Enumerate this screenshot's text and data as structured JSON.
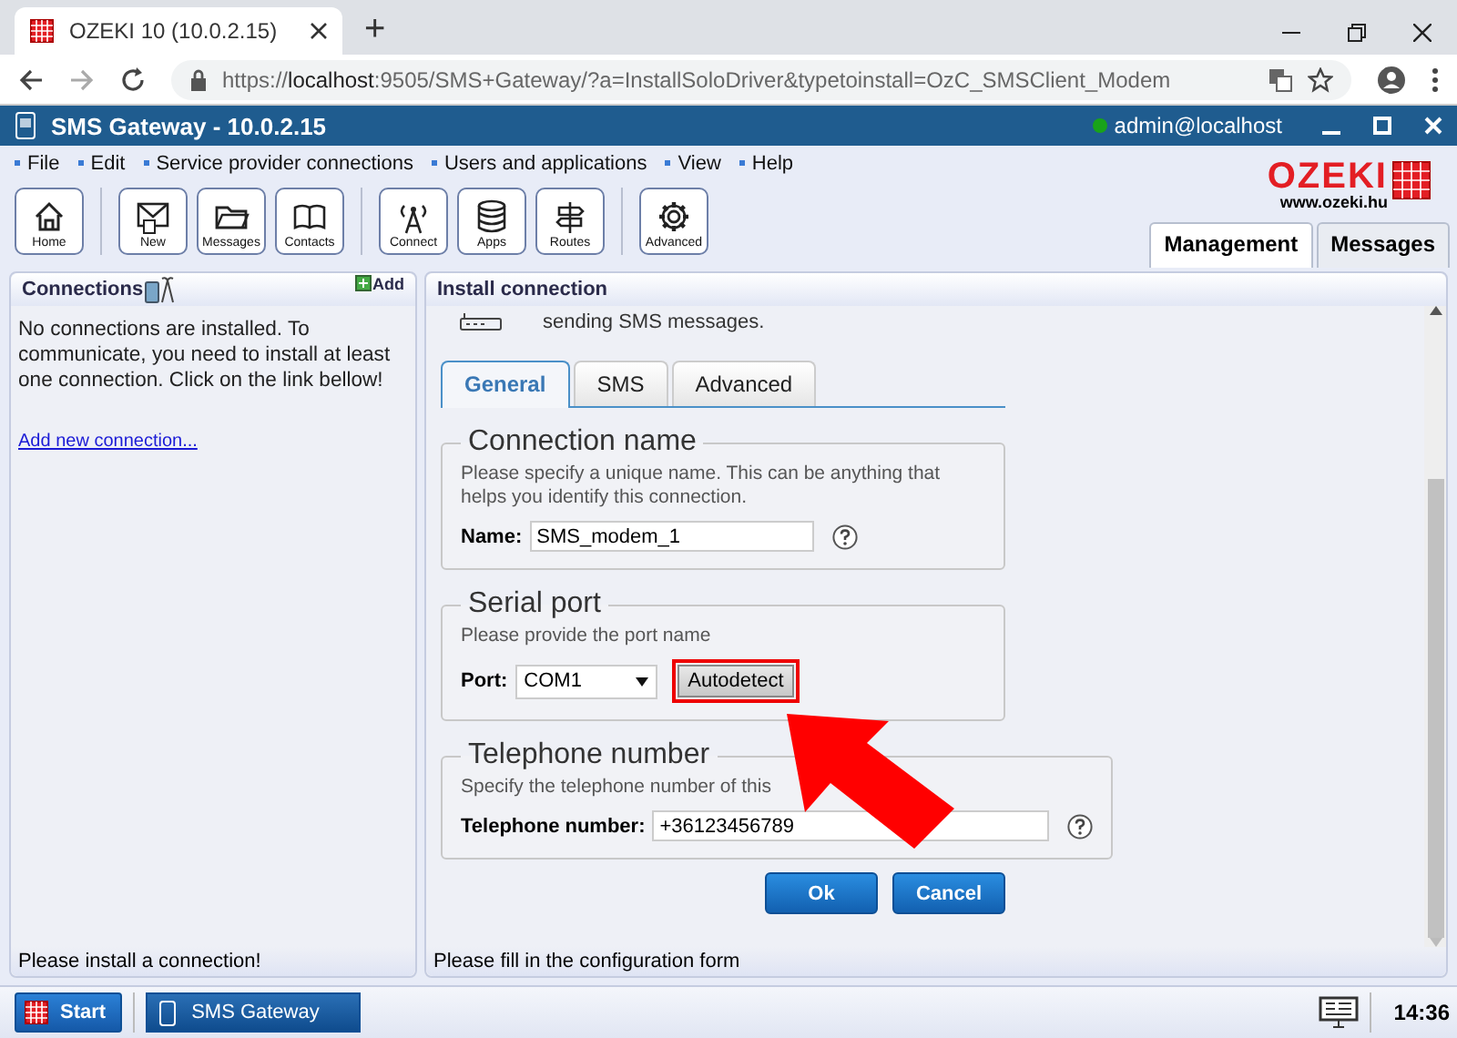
{
  "browser": {
    "tab_title": "OZEKI 10 (10.0.2.15)",
    "new_tab": "+",
    "url_scheme": "https://",
    "url_host": "localhost",
    "url_path": ":9505/SMS+Gateway/?a=InstallSoloDriver&typetoinstall=OzC_SMSClient_Modem"
  },
  "app": {
    "title": "SMS Gateway - 10.0.2.15",
    "user": "admin@localhost",
    "online": true
  },
  "menu": [
    "File",
    "Edit",
    "Service provider connections",
    "Users and applications",
    "View",
    "Help"
  ],
  "toolbar_groups": [
    [
      "Home"
    ],
    [
      "New",
      "Messages",
      "Contacts"
    ],
    [
      "Connect",
      "Apps",
      "Routes"
    ],
    [
      "Advanced"
    ]
  ],
  "logo": {
    "name": "OZEKI",
    "url": "www.ozeki.hu"
  },
  "view_tabs": [
    {
      "label": "Management",
      "selected": true
    },
    {
      "label": "Messages",
      "selected": false
    }
  ],
  "left_panel": {
    "title": "Connections",
    "add": "Add",
    "message": "No connections are installed. To communicate, you need to install at least one connection. Click on the link bellow!",
    "link": "Add new connection...",
    "status": "Please install a connection!"
  },
  "right_panel": {
    "title": "Install connection",
    "intro": "sending SMS messages.",
    "tabs": [
      {
        "label": "General",
        "selected": true
      },
      {
        "label": "SMS",
        "selected": false
      },
      {
        "label": "Advanced",
        "selected": false
      }
    ],
    "fieldsets": [
      {
        "legend": "Connection name",
        "hint": "Please specify a unique name. This can be anything that helps you identify this connection.",
        "field": {
          "kind": "text",
          "label": "Name:",
          "value": "SMS_modem_1",
          "help": true
        }
      },
      {
        "legend": "Serial port",
        "hint": "Please provide the port name",
        "field": {
          "kind": "select",
          "label": "Port:",
          "value": "COM1",
          "button": {
            "label": "Autodetect",
            "highlighted": true
          }
        }
      },
      {
        "legend": "Telephone number",
        "hint": "Specify the telephone number of this",
        "field": {
          "kind": "text",
          "label": "Telephone number:",
          "value": "+36123456789",
          "help": true
        }
      }
    ],
    "buttons": [
      "Ok",
      "Cancel"
    ],
    "status": "Please fill in the configuration form"
  },
  "taskbar": {
    "start": "Start",
    "apps": [
      {
        "label": "SMS Gateway",
        "selected": true
      }
    ],
    "clock": "14:36"
  }
}
